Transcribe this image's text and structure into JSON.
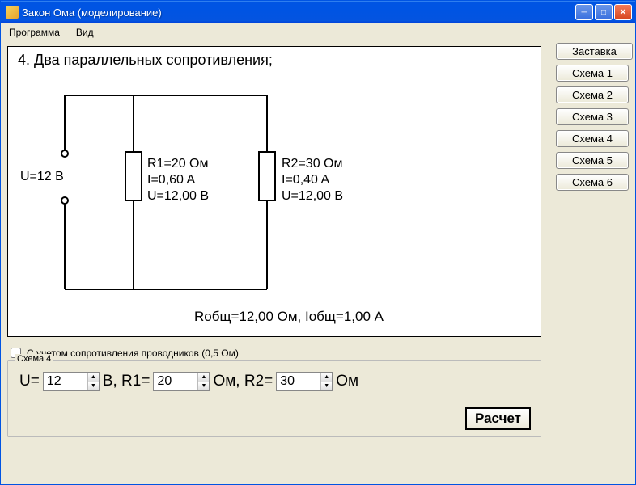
{
  "window": {
    "title": "Закон Ома (моделирование)"
  },
  "menu": {
    "program": "Программа",
    "view": "Вид"
  },
  "sidebar": {
    "splash": "Заставка",
    "scheme1": "Схема 1",
    "scheme2": "Схема 2",
    "scheme3": "Схема 3",
    "scheme4": "Схема 4",
    "scheme5": "Схема 5",
    "scheme6": "Схема 6"
  },
  "diagram": {
    "title": "4. Два параллельных сопротивления;",
    "source_label": "U=12 B",
    "r1": {
      "line1": "R1=20 Ом",
      "line2": "I=0,60 A",
      "line3": "U=12,00 B"
    },
    "r2": {
      "line1": "R2=30 Ом",
      "line2": "I=0,40 A",
      "line3": "U=12,00 B"
    },
    "totals": "Rобщ=12,00 Ом, Iобщ=1,00 A"
  },
  "checkbox": {
    "label": "С учетом сопротивления проводников (0,5 Ом)",
    "checked": false
  },
  "inputs": {
    "legend": "Схема 4",
    "u_label": "U=",
    "u_value": "12",
    "u_unit_r1_label": "В,  R1=",
    "r1_value": "20",
    "r1_unit_r2_label": "Ом,  R2=",
    "r2_value": "30",
    "r2_unit": "Ом",
    "calc": "Расчет"
  }
}
